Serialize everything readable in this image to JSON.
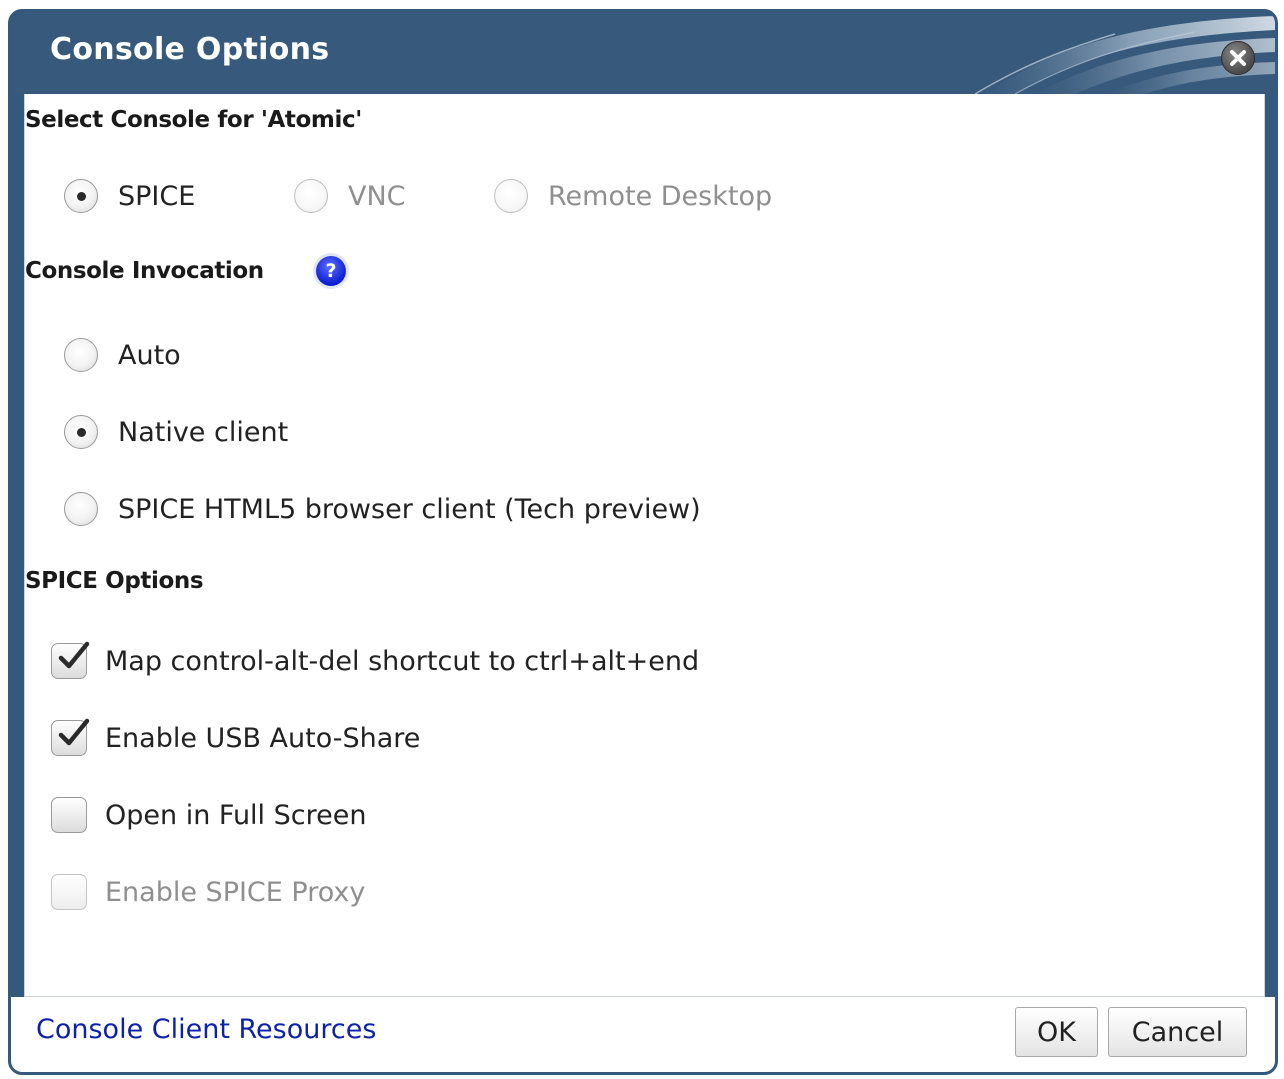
{
  "dialog": {
    "title": "Console Options"
  },
  "select_console": {
    "label": "Select Console for 'Atomic'",
    "options": [
      {
        "label": "SPICE",
        "checked": true,
        "disabled": false
      },
      {
        "label": "VNC",
        "checked": false,
        "disabled": true
      },
      {
        "label": "Remote Desktop",
        "checked": false,
        "disabled": true
      }
    ]
  },
  "invocation": {
    "label": "Console Invocation",
    "help_icon": "question-mark-icon",
    "options": [
      {
        "label": "Auto",
        "checked": false
      },
      {
        "label": "Native client",
        "checked": true
      },
      {
        "label": "SPICE HTML5 browser client (Tech preview)",
        "checked": false
      }
    ]
  },
  "spice_options": {
    "label": "SPICE Options",
    "options": [
      {
        "label": "Map control-alt-del shortcut to ctrl+alt+end",
        "checked": true,
        "disabled": false
      },
      {
        "label": "Enable USB Auto-Share",
        "checked": true,
        "disabled": false
      },
      {
        "label": "Open in Full Screen",
        "checked": false,
        "disabled": false
      },
      {
        "label": "Enable SPICE Proxy",
        "checked": false,
        "disabled": true
      }
    ]
  },
  "footer": {
    "link": "Console Client Resources",
    "ok_label": "OK",
    "cancel_label": "Cancel"
  },
  "colors": {
    "title_bar": "#37597b",
    "link": "#0d22a8",
    "help_icon": "#0a1ed0"
  }
}
